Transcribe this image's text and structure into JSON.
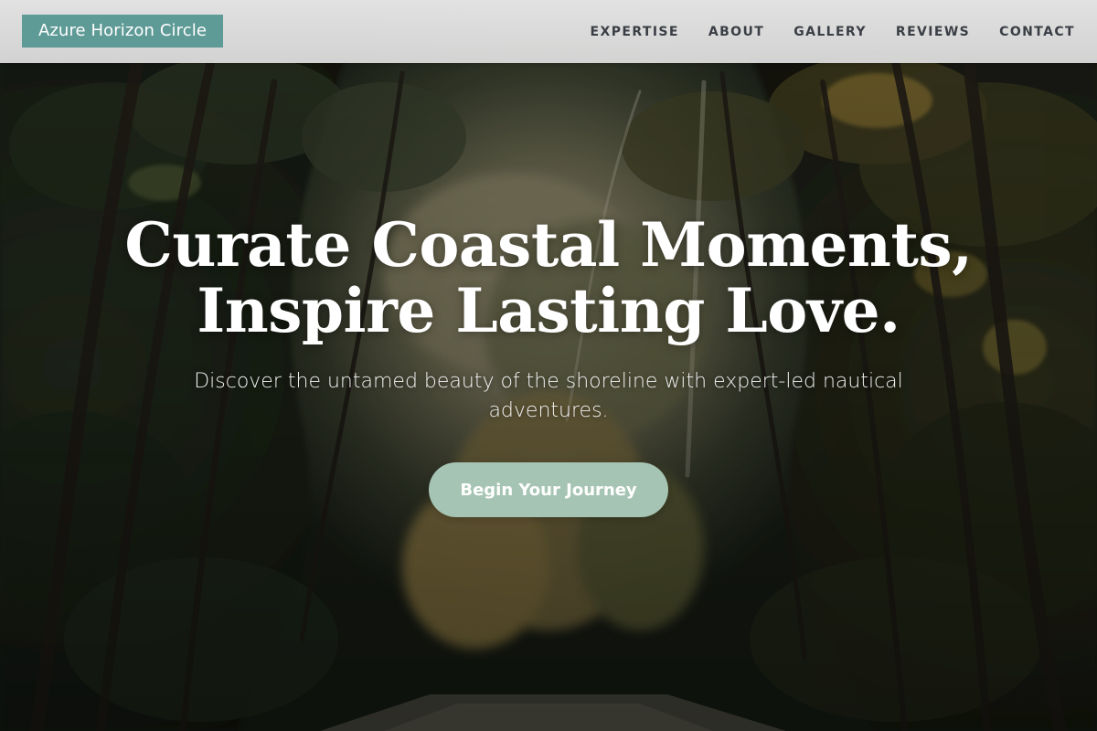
{
  "header": {
    "logo_text": "Azure Horizon Circle",
    "nav": [
      {
        "label": "EXPERTISE"
      },
      {
        "label": "ABOUT"
      },
      {
        "label": "GALLERY"
      },
      {
        "label": "REVIEWS"
      },
      {
        "label": "CONTACT"
      }
    ]
  },
  "hero": {
    "title_line1": "Curate Coastal Moments,",
    "title_line2": "Inspire Lasting Love.",
    "subtitle": "Discover the untamed beauty of the shoreline with expert-led nautical adventures.",
    "cta_label": "Begin Your Journey",
    "background": "forest-path-photo"
  },
  "colors": {
    "logo_bg": "#5e9a96",
    "cta_bg": "#a6c4b3",
    "nav_text": "#3a3e45",
    "header_bg": "#e4e4e4"
  }
}
